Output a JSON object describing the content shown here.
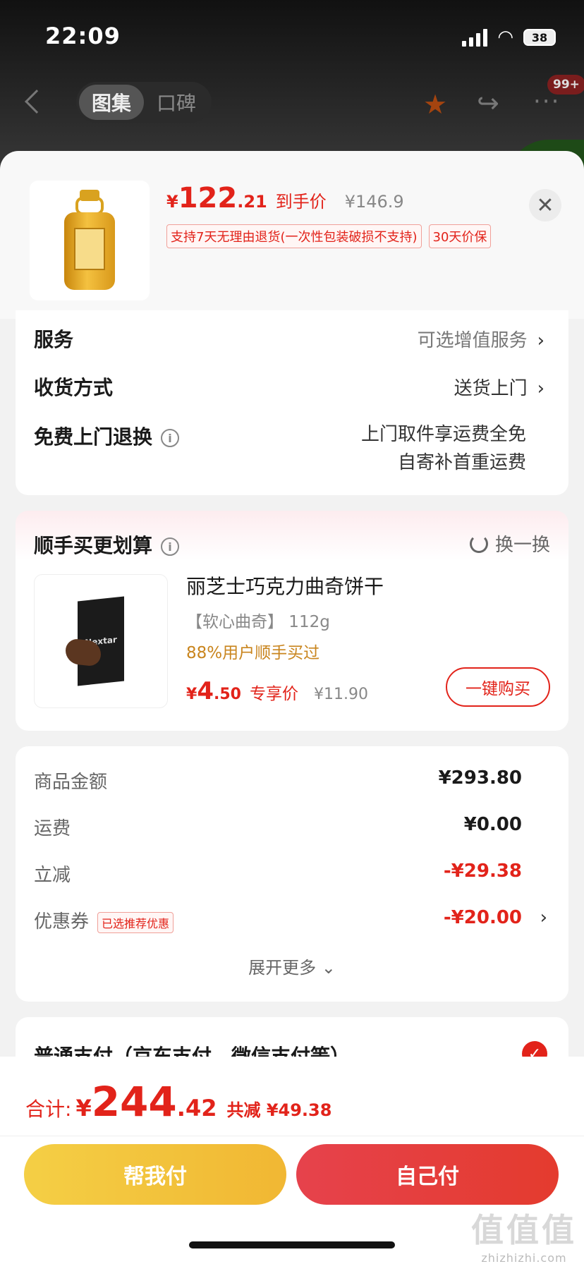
{
  "status_bar": {
    "time": "22:09",
    "battery": "38"
  },
  "nav": {
    "tabs": [
      {
        "label": "图集",
        "active": true
      },
      {
        "label": "口碑",
        "active": false
      }
    ],
    "badge": "99+"
  },
  "product": {
    "price_symbol": "¥",
    "price_int": "122",
    "price_dec": ".21",
    "price_tag": "到手价",
    "orig_price": "¥146.9",
    "tags": [
      "支持7天无理由退货(一次性包装破损不支持)",
      "30天价保"
    ],
    "close": "✕"
  },
  "service": {
    "rows": [
      {
        "label": "服务",
        "value": "可选增值服务"
      },
      {
        "label": "收货方式",
        "value": "送货上门"
      },
      {
        "label": "免费上门退换",
        "value_line1": "上门取件享运费全免",
        "value_line2": "自寄补首重运费"
      }
    ],
    "chevron": "›",
    "info": "i"
  },
  "addon": {
    "title": "顺手买更划算",
    "swap": "换一换",
    "name": "丽芝士巧克力曲奇饼干",
    "spec": "【软心曲奇】 112g",
    "hint": "88%用户顺手买过",
    "price_symbol": "¥",
    "price_int": "4",
    "price_dec": ".50",
    "price_tag": "专享价",
    "orig_price": "¥11.90",
    "buy_label": "一键购买",
    "box_text": "Nextar"
  },
  "summary": {
    "rows": [
      {
        "label": "商品金额",
        "value": "¥293.80"
      },
      {
        "label": "运费",
        "value": "¥0.00"
      },
      {
        "label": "立减",
        "value": "-¥29.38"
      },
      {
        "label": "优惠券",
        "badge": "已选推荐优惠",
        "value": "-¥20.00"
      }
    ],
    "expand": "展开更多 ⌄"
  },
  "payment": {
    "label": "普通支付（京东支付、微信支付等）",
    "check": "✓"
  },
  "bottom": {
    "total_label": "合计:",
    "total_symbol": "¥",
    "total_int": "244",
    "total_dec": ".42",
    "total_save": "共减 ¥49.38",
    "help_pay": "帮我付",
    "self_pay": "自己付"
  },
  "watermark": {
    "mark": "值值值",
    "url": "zhizhizhi.com"
  },
  "colors": {
    "accent": "#e2231a",
    "help_btn": "#f2c23c",
    "self_btn": "#e43b3b"
  }
}
